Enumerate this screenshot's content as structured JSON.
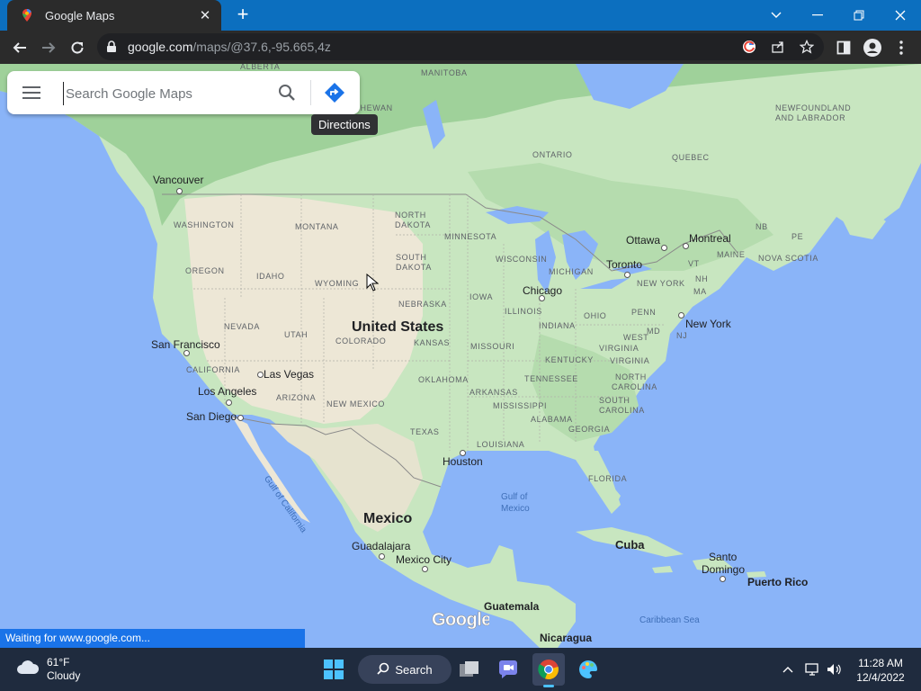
{
  "browser": {
    "tab_title": "Google Maps",
    "url_host": "google.com",
    "url_path": "/maps/@37.6,-95.665,4z"
  },
  "search": {
    "placeholder": "Search Google Maps",
    "tooltip": "Directions"
  },
  "map": {
    "countries": [
      "United States",
      "Mexico",
      "Cuba"
    ],
    "regions": [
      "ALBERTA",
      "MANITOBA",
      "SASKATCHEWAN",
      "ONTARIO",
      "QUEBEC",
      "NEWFOUNDLAND",
      "AND LABRADOR",
      "NB",
      "PE",
      "NOVA SCOTIA",
      "MAINE",
      "VT",
      "NH",
      "MA",
      "NEW YORK",
      "PENN",
      "MD",
      "NJ",
      "WEST",
      "VIRGINIA",
      "VIRGINIA",
      "NORTH",
      "CAROLINA",
      "SOUTH",
      "CAROLINA",
      "GEORGIA",
      "FLORIDA",
      "ALABAMA",
      "MISSISSIPPI",
      "TENNESSEE",
      "KENTUCKY",
      "OHIO",
      "INDIANA",
      "ILLINOIS",
      "MICHIGAN",
      "WISCONSIN",
      "MINNESOTA",
      "IOWA",
      "MISSOURI",
      "ARKANSAS",
      "LOUISIANA",
      "TEXAS",
      "OKLAHOMA",
      "KANSAS",
      "NEBRASKA",
      "SOUTH",
      "DAKOTA",
      "NORTH",
      "DAKOTA",
      "MONTANA",
      "WYOMING",
      "COLORADO",
      "NEW MEXICO",
      "ARIZONA",
      "UTAH",
      "NEVADA",
      "IDAHO",
      "OREGON",
      "WASHINGTON",
      "CALIFORNIA"
    ],
    "cities": [
      "Vancouver",
      "Ottawa",
      "Montreal",
      "Toronto",
      "Chicago",
      "New York",
      "San Francisco",
      "Las Vegas",
      "Los Angeles",
      "San Diego",
      "Houston",
      "Guadalajara",
      "Mexico City",
      "Guatemala",
      "Nicaragua",
      "Santo",
      "Domingo",
      "Puerto Rico"
    ],
    "waters": [
      "Gulf of",
      "Mexico",
      "Gulf of California",
      "Caribbean Sea"
    ],
    "logo": "Google",
    "status": "Waiting for www.google.com..."
  },
  "taskbar": {
    "weather_temp": "61°F",
    "weather_desc": "Cloudy",
    "search_label": "Search",
    "time": "11:28 AM",
    "date": "12/4/2022"
  },
  "colors": {
    "water": "#8ab4f8",
    "land": "#c8e6c0",
    "arid": "#ede7d6",
    "accent": "#1a73e8",
    "titlebar": "#0c6fbf",
    "taskbar": "#1f2b3e"
  }
}
